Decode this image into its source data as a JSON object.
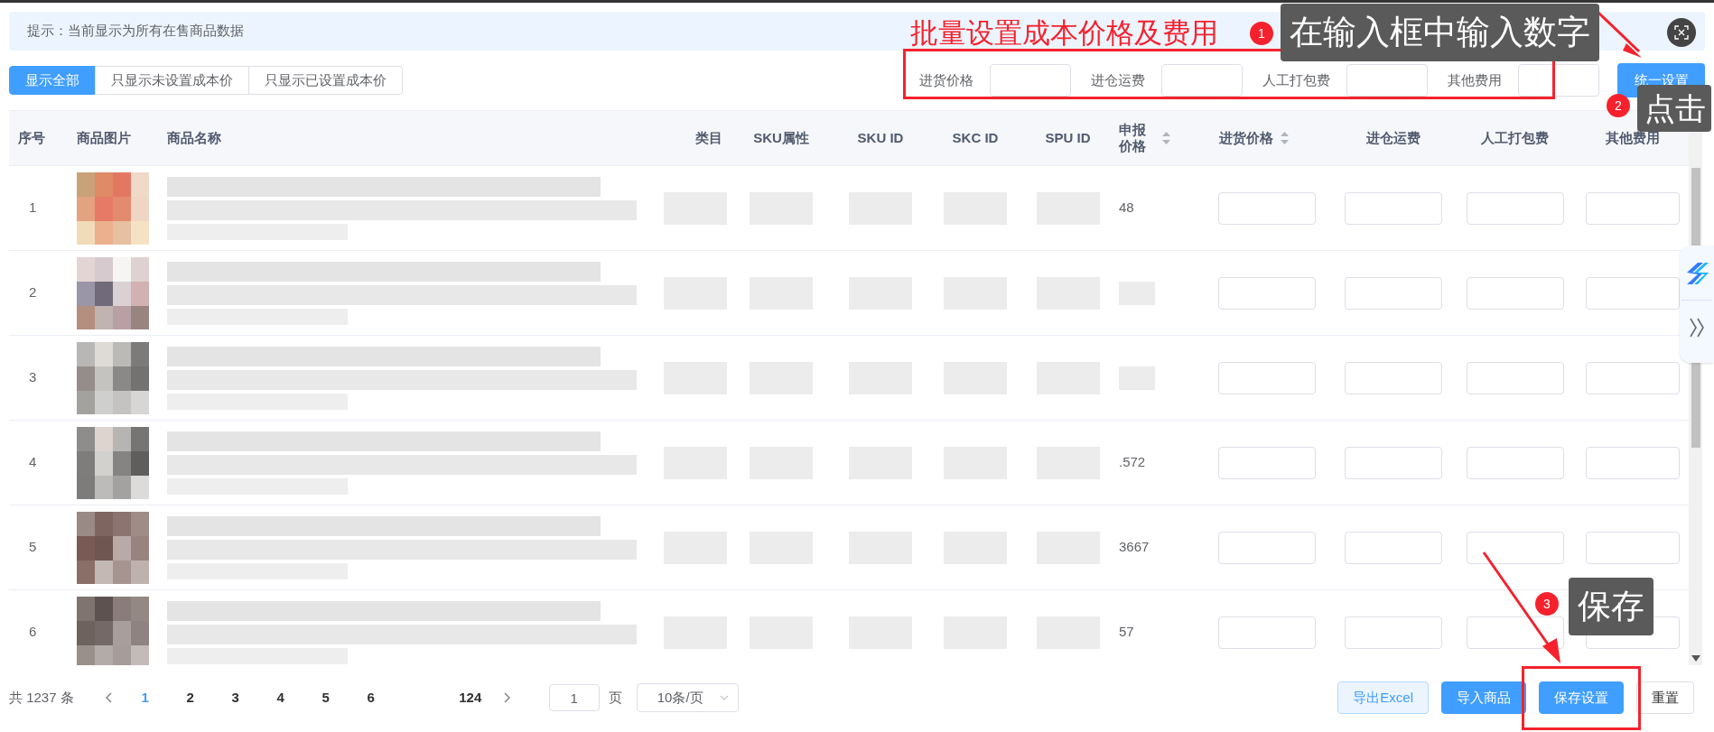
{
  "notice": "提示：当前显示为所有在售商品数据",
  "filter_tabs": [
    {
      "label": "显示全部",
      "selected": true
    },
    {
      "label": "只显示未设置成本价",
      "selected": false
    },
    {
      "label": "只显示已设置成本价",
      "selected": false
    }
  ],
  "batch_fields": [
    {
      "label": "进货价格"
    },
    {
      "label": "进仓运费"
    },
    {
      "label": "人工打包费"
    },
    {
      "label": "其他费用"
    }
  ],
  "batch_button": "统一设置",
  "table": {
    "columns": [
      {
        "label": "序号",
        "sortable": false
      },
      {
        "label": "商品图片",
        "sortable": false
      },
      {
        "label": "商品名称",
        "sortable": false
      },
      {
        "label": "类目",
        "sortable": false
      },
      {
        "label": "SKU属性",
        "sortable": false
      },
      {
        "label": "SKU ID",
        "sortable": false
      },
      {
        "label": "SKC ID",
        "sortable": false
      },
      {
        "label": "SPU ID",
        "sortable": false
      },
      {
        "label": "申报价格",
        "sortable": true
      },
      {
        "label": "进货价格",
        "sortable": true
      },
      {
        "label": "进仓运费",
        "sortable": false
      },
      {
        "label": "人工打包费",
        "sortable": false
      },
      {
        "label": "其他费用",
        "sortable": false
      }
    ],
    "rows": [
      {
        "index": "1",
        "declared_price": "48"
      },
      {
        "index": "2"
      },
      {
        "index": "3"
      },
      {
        "index": "4",
        "declared_price": ".572"
      },
      {
        "index": "5",
        "declared_price": "3667"
      },
      {
        "index": "6",
        "declared_price": "57"
      }
    ]
  },
  "pagination": {
    "total": "共 1237 条",
    "pages": [
      {
        "label": "1",
        "selected": true
      },
      {
        "label": "2",
        "selected": false
      },
      {
        "label": "3",
        "selected": false
      },
      {
        "label": "4",
        "selected": false
      },
      {
        "label": "5",
        "selected": false
      },
      {
        "label": "6",
        "selected": false
      },
      {
        "label": "124",
        "selected": false
      }
    ],
    "jump_value": "1",
    "jump_suffix": "页",
    "page_size": "10条/页"
  },
  "actions": [
    {
      "label": "导出Excel",
      "kind": "secondary"
    },
    {
      "label": "导入商品",
      "kind": "primary"
    },
    {
      "label": "保存设置",
      "kind": "primary"
    },
    {
      "label": "重置",
      "kind": "default"
    }
  ],
  "annotations": {
    "title": "批量设置成本价格及费用",
    "callouts": [
      {
        "number": "1",
        "text": "在输入框中输入数字"
      },
      {
        "number": "2",
        "text": "点击"
      },
      {
        "number": "3",
        "text": "保存"
      }
    ]
  }
}
